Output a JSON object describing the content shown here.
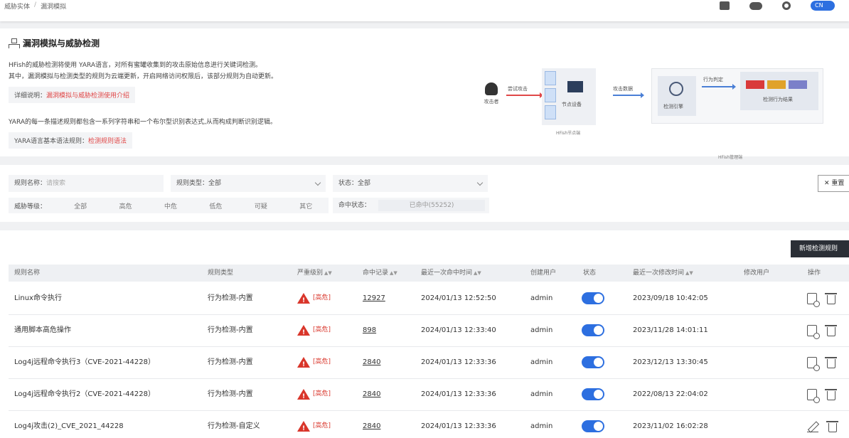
{
  "topbar": {
    "breadcrumb": [
      "威胁实体",
      "漏洞模拟"
    ],
    "lang": "CN",
    "icons": [
      "report-icon",
      "chat-icon",
      "gear-icon"
    ]
  },
  "intro": {
    "title": "漏洞模拟与威胁检测",
    "desc_line1": "HFish的威胁检测将使用 YARA语言，对所有蜜罐收集到的攻击原始信息进行关键词检测。",
    "desc_line2": "其中，漏洞模拟与检测类型的规则为云端更新，开启网络访问权限后，该部分规则为自动更新。",
    "detail_label": "详细说明：",
    "detail_link": "漏洞模拟与威胁检测使用介绍",
    "yara_desc": "YARA的每一条描述规则都包含一系列字符串和一个布尔型识别表达式,从而构成判断识别逻辑。",
    "yara_label": "YARA语言基本语法规则：",
    "yara_link": "检测规则语法"
  },
  "diagram": {
    "attacker": "攻击者",
    "attack_arrow": "尝试攻击",
    "node_device": "节点设备",
    "node_caption": "HFish节点端",
    "attack_data": "攻击数据",
    "engine": "检测引擎",
    "behavior_judge": "行为判定",
    "result": "检测行为结果",
    "mgr_caption": "HFish管理端",
    "chip_colors": [
      "#d93a3a",
      "#e0a22a",
      "#7b80c9"
    ]
  },
  "filters": {
    "name_label": "规则名称：",
    "name_placeholder": "请搜索",
    "type_label": "规则类型：",
    "type_value": "全部",
    "status_label": "状态：",
    "status_value": "全部",
    "level_label": "威胁等级：",
    "levels": [
      "全部",
      "高危",
      "中危",
      "低危",
      "可疑",
      "其它"
    ],
    "hit_label": "命中状态：",
    "hit_value": "已命中(55252)",
    "reset": "重置"
  },
  "table": {
    "add_button": "新增检测规则",
    "headers": {
      "name": "规则名称",
      "type": "规则类型",
      "severity": "严重级别",
      "hits": "命中记录",
      "last_hit": "最近一次命中时间",
      "creator": "创建用户",
      "status": "状态",
      "last_mod": "最近一次修改时间",
      "modifier": "修改用户",
      "ops": "操作"
    },
    "rows": [
      {
        "name": "Linux命令执行",
        "type": "行为检测-内置",
        "severity": "[高危]",
        "hits": "12927",
        "last_hit": "2024/01/13 12:52:50",
        "creator": "admin",
        "last_mod": "2023/09/18 10:42:05",
        "edit": "doc"
      },
      {
        "name": "通用脚本高危操作",
        "type": "行为检测-内置",
        "severity": "[高危]",
        "hits": "898",
        "last_hit": "2024/01/13 12:33:40",
        "creator": "admin",
        "last_mod": "2023/11/28 14:01:11",
        "edit": "doc"
      },
      {
        "name": "Log4j远程命令执行3（CVE-2021-44228）",
        "type": "行为检测-内置",
        "severity": "[高危]",
        "hits": "2840",
        "last_hit": "2024/01/13 12:33:36",
        "creator": "admin",
        "last_mod": "2023/12/13 13:30:45",
        "edit": "doc"
      },
      {
        "name": "Log4j远程命令执行2（CVE-2021-44228）",
        "type": "行为检测-内置",
        "severity": "[高危]",
        "hits": "2840",
        "last_hit": "2024/01/13 12:33:36",
        "creator": "admin",
        "last_mod": "2022/08/13 22:04:02",
        "edit": "doc"
      },
      {
        "name": "Log4j攻击(2)_CVE_2021_44228",
        "type": "行为检测-自定义",
        "severity": "[高危]",
        "hits": "2840",
        "last_hit": "2024/01/13 12:33:36",
        "creator": "admin",
        "last_mod": "2023/11/02 16:02:28",
        "edit": "pencil"
      }
    ]
  }
}
